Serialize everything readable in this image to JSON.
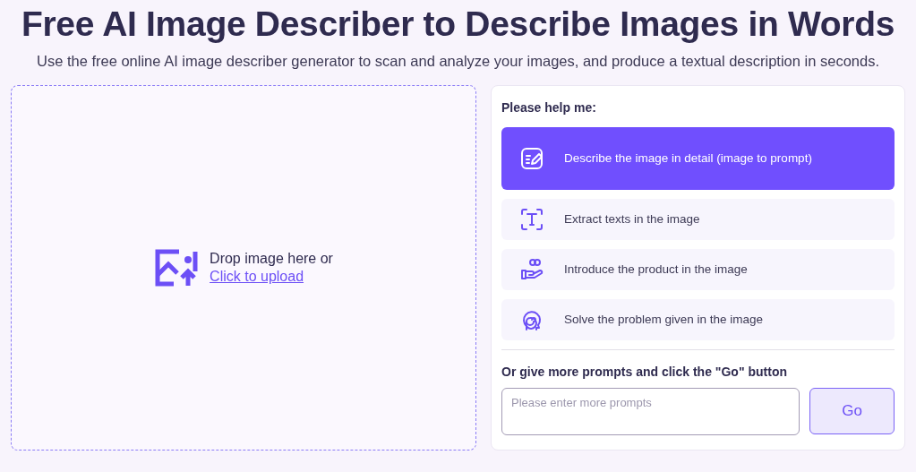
{
  "title": "Free AI Image Describer to Describe Images in Words",
  "subtitle": "Use the free online AI image describer generator to scan and analyze your images, and produce a textual description in seconds.",
  "upload": {
    "prompt": "Drop image here or",
    "link": "Click to upload"
  },
  "panel": {
    "heading": "Please help me:",
    "options": [
      {
        "kind": "describe",
        "label": "Describe the image in detail (image to prompt)",
        "selected": true
      },
      {
        "kind": "extract",
        "label": "Extract texts in the image",
        "selected": false
      },
      {
        "kind": "product",
        "label": "Introduce the product in the image",
        "selected": false
      },
      {
        "kind": "solve",
        "label": "Solve the problem given in the image",
        "selected": false
      }
    ],
    "more_heading": "Or give more prompts and click the \"Go\" button",
    "prompt_field": {
      "placeholder": "Please enter more prompts"
    },
    "go_button": "Go"
  }
}
